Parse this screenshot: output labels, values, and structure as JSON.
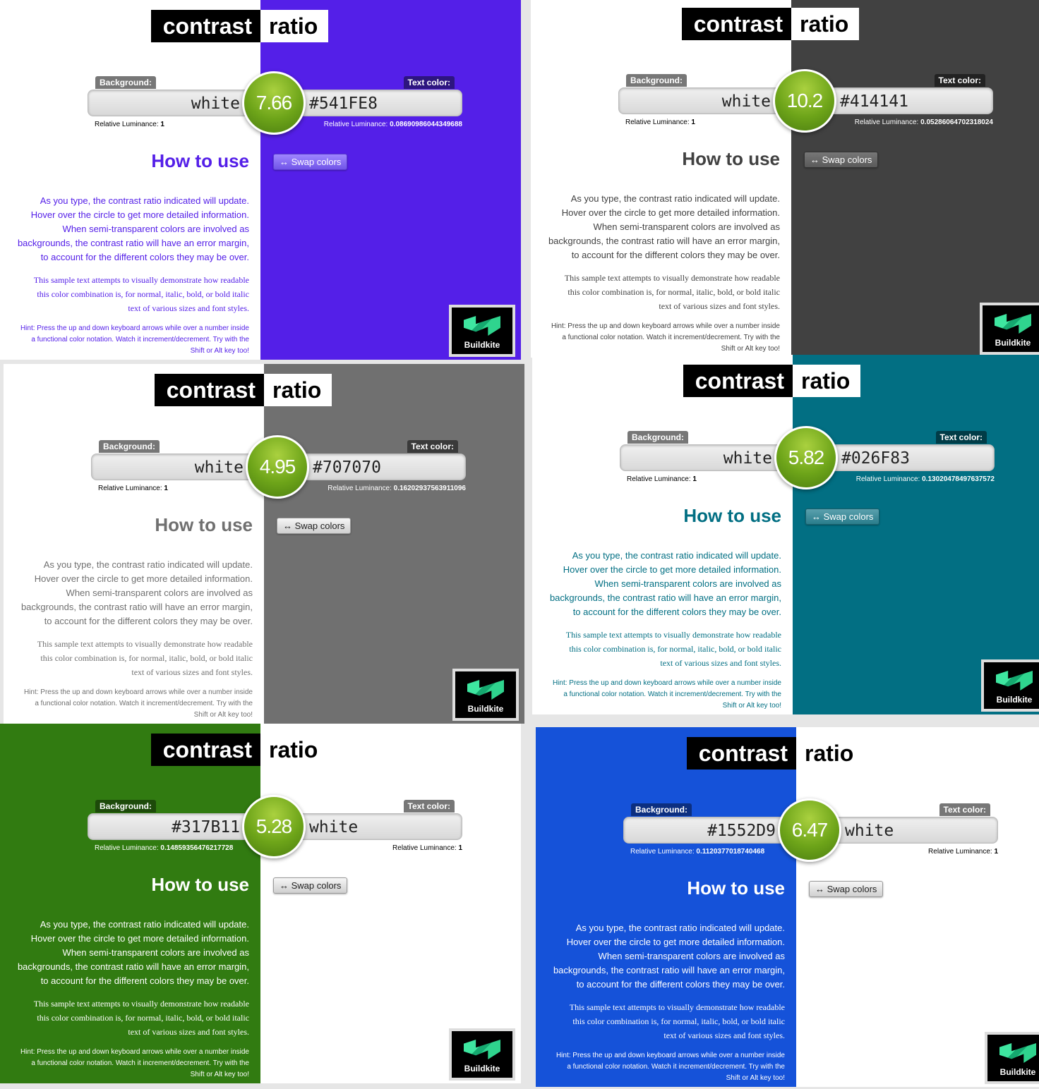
{
  "common": {
    "title_contrast": "contrast",
    "title_ratio": "ratio",
    "bg_label": "Background:",
    "text_label": "Text color:",
    "lum_prefix": "Relative Luminance:",
    "how_to_use": "How to use",
    "swap": "↔ Swap colors",
    "p1": [
      "As you type, the contrast ratio indicated will update.",
      "Hover over the circle to get more detailed information.",
      "When semi-transparent colors are involved as",
      "backgrounds, the contrast ratio will have an error margin,",
      "to account for the different colors they may be over."
    ],
    "p2": [
      "This sample text attempts to visually demonstrate how readable",
      "this color combination is, for normal, italic, bold, or bold italic",
      "text of various sizes and font styles."
    ],
    "hint": [
      "Hint: Press the up and down keyboard arrows while over a number inside",
      "a functional color notation. Watch it increment/decrement. Try with the",
      "Shift or Alt key too!"
    ],
    "logo": "Buildkite"
  },
  "panels": [
    {
      "bg": "white",
      "fg": "#541FE8",
      "ratio": "7.66",
      "bg_lum": "1",
      "fg_lum": "0.08690986044349688",
      "left_color": "#ffffff",
      "right_color": "#541FE8",
      "text_color": "#541FE8",
      "label_left_bg": "#777",
      "label_right_bg": "#2d1580"
    },
    {
      "bg": "white",
      "fg": "#414141",
      "ratio": "10.2",
      "bg_lum": "1",
      "fg_lum": "0.05286064702318024",
      "left_color": "#ffffff",
      "right_color": "#414141",
      "text_color": "#414141",
      "label_left_bg": "#777",
      "label_right_bg": "#222"
    },
    {
      "bg": "white",
      "fg": "#707070",
      "ratio": "4.95",
      "bg_lum": "1",
      "fg_lum": "0.16202937563911096",
      "left_color": "#ffffff",
      "right_color": "#707070",
      "text_color": "#707070",
      "label_left_bg": "#777",
      "label_right_bg": "#3a3a3a"
    },
    {
      "bg": "white",
      "fg": "#026F83",
      "ratio": "5.82",
      "bg_lum": "1",
      "fg_lum": "0.13020478497637572",
      "left_color": "#ffffff",
      "right_color": "#026F83",
      "text_color": "#026F83",
      "label_left_bg": "#777",
      "label_right_bg": "#013c47"
    },
    {
      "bg": "#317B11",
      "fg": "white",
      "ratio": "5.28",
      "bg_lum": "0.14859356476217728",
      "fg_lum": "1",
      "left_color": "#317B11",
      "right_color": "#ffffff",
      "text_color": "#ffffff",
      "label_left_bg": "#1d4a0a",
      "label_right_bg": "#777"
    },
    {
      "bg": "#1552D9",
      "fg": "white",
      "ratio": "6.47",
      "bg_lum": "0.1120377018740468",
      "fg_lum": "1",
      "left_color": "#1552D9",
      "right_color": "#ffffff",
      "text_color": "#ffffff",
      "label_left_bg": "#0c2f80",
      "label_right_bg": "#777"
    }
  ]
}
